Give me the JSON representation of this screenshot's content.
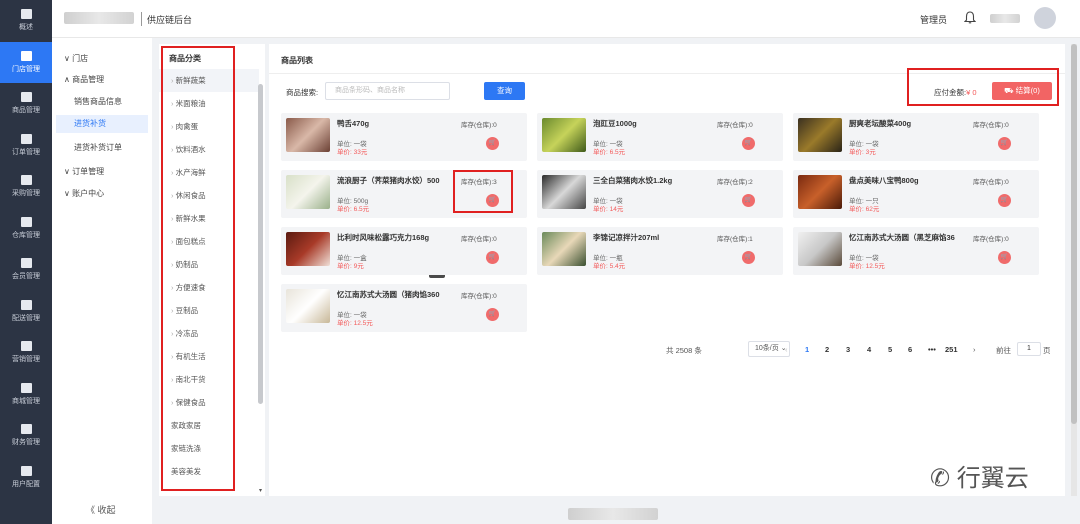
{
  "leftnav": [
    {
      "label": "概述",
      "icon": "home-icon"
    },
    {
      "label": "门店管理",
      "icon": "store-icon",
      "active": true
    },
    {
      "label": "商品管理",
      "icon": "goods-icon"
    },
    {
      "label": "订单管理",
      "icon": "order-icon"
    },
    {
      "label": "采购管理",
      "icon": "purchase-icon"
    },
    {
      "label": "仓库管理",
      "icon": "warehouse-icon"
    },
    {
      "label": "会员管理",
      "icon": "member-icon"
    },
    {
      "label": "配送管理",
      "icon": "truck-icon"
    },
    {
      "label": "营销管理",
      "icon": "chart-icon"
    },
    {
      "label": "商城管理",
      "icon": "mall-icon"
    },
    {
      "label": "财务管理",
      "icon": "finance-icon"
    },
    {
      "label": "用户配置",
      "icon": "shield-icon"
    }
  ],
  "topbar": {
    "title": "供应链后台",
    "admin": "管理员"
  },
  "subnav": {
    "store": "门店",
    "goods_mgmt": "商品管理",
    "sales_info": "销售商品信息",
    "restock": "进货补货",
    "restock_order": "进货补货订单",
    "order_mgmt": "订单管理",
    "account": "账户中心",
    "collapse": "收起"
  },
  "categories": {
    "title": "商品分类",
    "items": [
      "新鲜蔬菜",
      "米面粮油",
      "肉禽蛋",
      "饮料酒水",
      "水产海鲜",
      "休闲食品",
      "新鲜水果",
      "面包糕点",
      "奶制品",
      "方便速食",
      "豆制品",
      "冷冻品",
      "有机生活",
      "南北干货",
      "保健食品",
      "家政家居",
      "家链洗涤",
      "美容美发"
    ]
  },
  "main": {
    "title": "商品列表",
    "search_label": "商品搜索:",
    "search_placeholder": "商品条形码、商品名称",
    "search_btn": "查询",
    "pay_label": "应付金额:",
    "pay_amount": "¥ 0",
    "settle_btn": "结算(0)",
    "tooltip": "'0'"
  },
  "products": [
    {
      "name": "鸭舌470g",
      "stock": "库存(仓库):0",
      "unit": "单位: 一袋",
      "price": "单价: 33元"
    },
    {
      "name": "泡豇豆1000g",
      "stock": "库存(仓库):0",
      "unit": "单位: 一袋",
      "price": "单价: 6.5元"
    },
    {
      "name": "厨爽老坛酸菜400g",
      "stock": "库存(仓库):0",
      "unit": "单位: 一袋",
      "price": "单价: 3元"
    },
    {
      "name": "流浪厨子（荠菜猪肉水饺）500",
      "stock": "库存(仓库):3",
      "unit": "单位: 500g",
      "price": "单价: 6.5元"
    },
    {
      "name": "三全白菜猪肉水饺1.2kg",
      "stock": "库存(仓库):2",
      "unit": "单位: 一袋",
      "price": "单价: 14元"
    },
    {
      "name": "盘点美味八宝鸭800g",
      "stock": "库存(仓库):0",
      "unit": "单位: 一只",
      "price": "单价: 62元"
    },
    {
      "name": "比利时风味松露巧克力168g",
      "stock": "库存(仓库):0",
      "unit": "单位: 一盒",
      "price": "单价: 9元"
    },
    {
      "name": "李锦记凉拌汁207ml",
      "stock": "库存(仓库):1",
      "unit": "单位: 一瓶",
      "price": "单价: 5.4元"
    },
    {
      "name": "忆江南苏式大汤圆（黑芝麻馅36",
      "stock": "库存(仓库):0",
      "unit": "单位: 一袋",
      "price": "单价: 12.5元"
    },
    {
      "name": "忆江南苏式大汤圆（猪肉馅360",
      "stock": "库存(仓库):0",
      "unit": "单位: 一袋",
      "price": "单价: 12.5元"
    }
  ],
  "pagination": {
    "total": "共 2508 条",
    "size": "10条/页",
    "pages": [
      "1",
      "2",
      "3",
      "4",
      "5",
      "6",
      "•••",
      "251"
    ],
    "goto_label": "前往",
    "goto_value": "1",
    "page_suffix": "页"
  },
  "watermark": "行翼云",
  "colors": {
    "accent": "#2d78f4",
    "danger": "#f26464",
    "nav_bg": "#2c3444",
    "annotation": "#e02020"
  }
}
